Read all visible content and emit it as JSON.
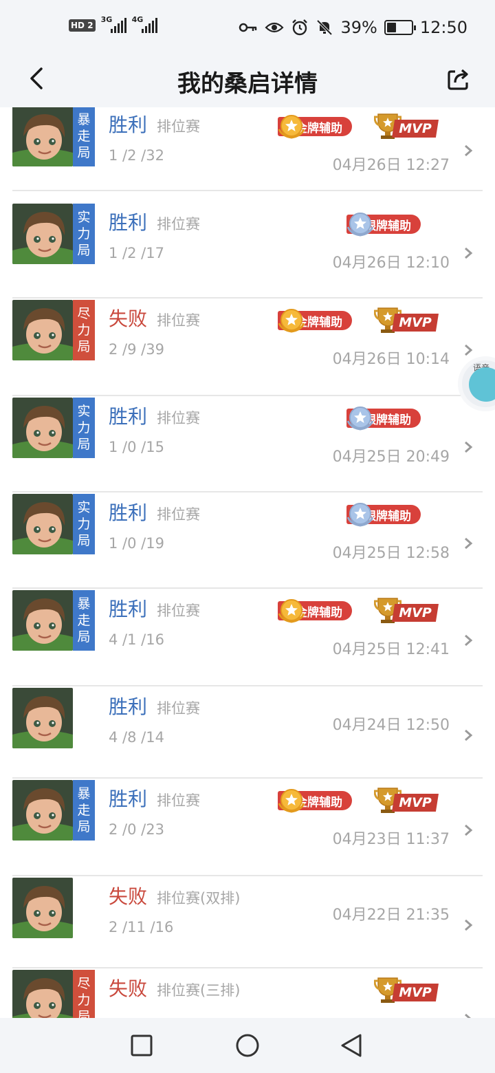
{
  "status": {
    "hd_label": "HD",
    "sim": "2",
    "net1": "3G",
    "net2": "4G",
    "battery_pct": "39%",
    "battery_level": 0.39,
    "time": "12:50"
  },
  "header": {
    "title": "我的桑启详情"
  },
  "float_button": {
    "label": "语音"
  },
  "rows": [
    {
      "result": "胜利",
      "mode": "排位赛",
      "kda": "1 /2 /32",
      "time": "04月26日 12:27",
      "tag": [
        "暴",
        "走",
        "局"
      ],
      "badge": "金牌辅助",
      "mvp": "MVP"
    },
    {
      "result": "胜利",
      "mode": "排位赛",
      "kda": "1 /2 /17",
      "time": "04月26日 12:10",
      "tag": [
        "实",
        "力",
        "局"
      ],
      "badge": "银牌辅助"
    },
    {
      "result": "失败",
      "mode": "排位赛",
      "kda": "2 /9 /39",
      "time": "04月26日 10:14",
      "tag": [
        "尽",
        "力",
        "局"
      ],
      "badge": "金牌辅助",
      "mvp": "MVP"
    },
    {
      "result": "胜利",
      "mode": "排位赛",
      "kda": "1 /0 /15",
      "time": "04月25日 20:49",
      "tag": [
        "实",
        "力",
        "局"
      ],
      "badge": "银牌辅助"
    },
    {
      "result": "胜利",
      "mode": "排位赛",
      "kda": "1 /0 /19",
      "time": "04月25日 12:58",
      "tag": [
        "实",
        "力",
        "局"
      ],
      "badge": "银牌辅助"
    },
    {
      "result": "胜利",
      "mode": "排位赛",
      "kda": "4 /1 /16",
      "time": "04月25日 12:41",
      "tag": [
        "暴",
        "走",
        "局"
      ],
      "badge": "金牌辅助",
      "mvp": "MVP"
    },
    {
      "result": "胜利",
      "mode": "排位赛",
      "kda": "4 /8 /14",
      "time": "04月24日 12:50"
    },
    {
      "result": "胜利",
      "mode": "排位赛",
      "kda": "2 /0 /23",
      "time": "04月23日 11:37",
      "tag": [
        "暴",
        "走",
        "局"
      ],
      "badge": "金牌辅助",
      "mvp": "MVP"
    },
    {
      "result": "失败",
      "mode": "排位赛(双排)",
      "kda": "2 /11 /16",
      "time": "04月22日 21:35"
    },
    {
      "result": "失败",
      "mode": "排位赛(三排)",
      "tag": [
        "尽",
        "力",
        "局"
      ],
      "mvp": "MVP"
    }
  ]
}
